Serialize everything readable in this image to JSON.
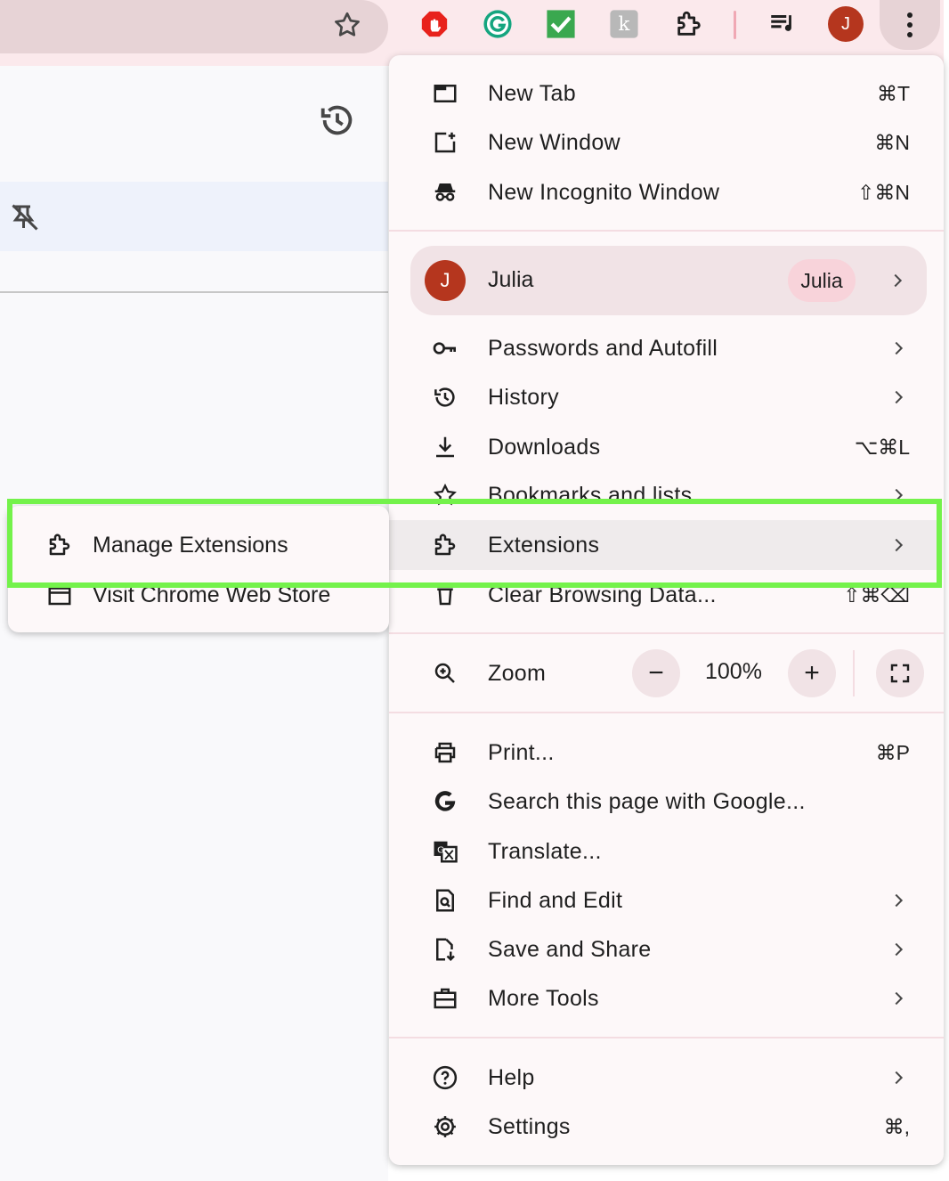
{
  "toolbar": {
    "avatar_letter": "J",
    "extensions": [
      "adblock-icon",
      "grammarly-icon",
      "checkmark-extension-icon",
      "k-extension-icon",
      "puzzle-extensions-icon",
      "media-queue-icon"
    ]
  },
  "menu": {
    "new_tab": {
      "label": "New Tab",
      "shortcut": "⌘T"
    },
    "new_window": {
      "label": "New Window",
      "shortcut": "⌘N"
    },
    "new_incognito": {
      "label": "New Incognito Window",
      "shortcut": "⇧⌘N"
    },
    "profile": {
      "avatar_letter": "J",
      "name": "Julia",
      "chip": "Julia"
    },
    "passwords": {
      "label": "Passwords and Autofill"
    },
    "history": {
      "label": "History"
    },
    "downloads": {
      "label": "Downloads",
      "shortcut": "⌥⌘L"
    },
    "bookmarks": {
      "label": "Bookmarks and lists"
    },
    "extensions": {
      "label": "Extensions"
    },
    "clear_data": {
      "label": "Clear Browsing Data...",
      "shortcut": "⇧⌘⌫"
    },
    "zoom": {
      "label": "Zoom",
      "minus": "−",
      "value": "100%",
      "plus": "+"
    },
    "print": {
      "label": "Print...",
      "shortcut": "⌘P"
    },
    "search_google": {
      "label": "Search this page with Google..."
    },
    "translate": {
      "label": "Translate..."
    },
    "find_edit": {
      "label": "Find and Edit"
    },
    "save_share": {
      "label": "Save and Share"
    },
    "more_tools": {
      "label": "More Tools"
    },
    "help": {
      "label": "Help"
    },
    "settings": {
      "label": "Settings",
      "shortcut": "⌘,"
    }
  },
  "submenu": {
    "manage_extensions": "Manage Extensions",
    "visit_store": "Visit Chrome Web Store"
  },
  "colors": {
    "avatar": "#b5361e",
    "annotation": "#74f24b",
    "menu_bg": "#fdf8f9",
    "toolbar_bg": "#fbe9ec"
  }
}
